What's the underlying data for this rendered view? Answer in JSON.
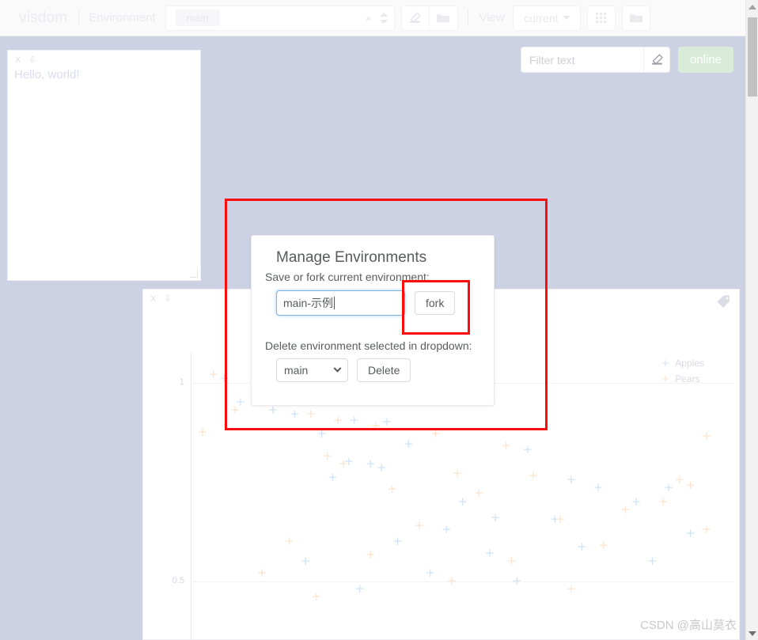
{
  "topbar": {
    "brand": "visdom",
    "env_label": "Environment",
    "env_tag": "main",
    "clear_icon": "×",
    "spinner_up_icon": "caret-up-icon",
    "spinner_down_icon": "caret-down-icon",
    "eraser_icon": "◣",
    "folder_icon": "🗀",
    "view_label": "View",
    "current_dropdown": "current",
    "grid_icon": "grid-icon",
    "folder_icon_2": "🗀"
  },
  "filterbar": {
    "filter_placeholder": "Filter text",
    "filter_value": "",
    "clear_icon": "◣",
    "status_badge": "online",
    "status_color": "#d8ecd9"
  },
  "text_pane": {
    "close_icon": "X",
    "save_icon": "⇩",
    "content": "Hello, world!"
  },
  "plot_pane": {
    "close_icon": "X",
    "save_icon": "⇩",
    "tag_icon": "tag-icon"
  },
  "modal": {
    "title": "Manage Environments",
    "save_label": "Save or fork current environment:",
    "env_name_value": "main-示例",
    "fork_button": "fork",
    "delete_label": "Delete environment selected in dropdown:",
    "env_dropdown_value": "main",
    "delete_button": "Delete"
  },
  "annotations": {
    "outer_rect_color": "#fb0d0d",
    "fork_rect_color": "#fb0d0d"
  },
  "watermark": "CSDN @高山莫衣",
  "scrollbar": {
    "up_arrow": "scroll-up-icon",
    "down_arrow": "scroll-down-icon"
  },
  "chart_data": {
    "type": "scatter",
    "title": "",
    "xlabel": "",
    "ylabel": "",
    "grid": true,
    "legend_position": "top-right",
    "yticks": [
      1,
      0.5
    ],
    "ytick_labels": [
      "1",
      "0.5"
    ],
    "ylim": [
      0.35,
      1.08
    ],
    "xlim": [
      0,
      1
    ],
    "series": [
      {
        "name": "Apples",
        "color": "#cfe3f7",
        "marker": "+",
        "points": [
          [
            0.06,
            1.01
          ],
          [
            0.09,
            0.95
          ],
          [
            0.15,
            0.93
          ],
          [
            0.19,
            0.92
          ],
          [
            0.3,
            0.905
          ],
          [
            0.36,
            0.9
          ],
          [
            0.24,
            0.87
          ],
          [
            0.4,
            0.845
          ],
          [
            0.62,
            0.83
          ],
          [
            0.29,
            0.8
          ],
          [
            0.33,
            0.795
          ],
          [
            0.35,
            0.785
          ],
          [
            0.26,
            0.76
          ],
          [
            0.7,
            0.755
          ],
          [
            0.75,
            0.735
          ],
          [
            0.88,
            0.735
          ],
          [
            0.5,
            0.7
          ],
          [
            0.82,
            0.7
          ],
          [
            0.56,
            0.66
          ],
          [
            0.67,
            0.655
          ],
          [
            0.47,
            0.63
          ],
          [
            0.92,
            0.62
          ],
          [
            0.38,
            0.6
          ],
          [
            0.72,
            0.585
          ],
          [
            0.55,
            0.57
          ],
          [
            0.21,
            0.55
          ],
          [
            0.85,
            0.55
          ],
          [
            0.44,
            0.52
          ],
          [
            0.6,
            0.5
          ],
          [
            0.31,
            0.48
          ]
        ]
      },
      {
        "name": "Pears",
        "color": "#fde4cc",
        "marker": "+",
        "points": [
          [
            0.04,
            1.02
          ],
          [
            0.12,
            0.99
          ],
          [
            0.17,
            0.98
          ],
          [
            0.08,
            0.93
          ],
          [
            0.22,
            0.92
          ],
          [
            0.27,
            0.905
          ],
          [
            0.34,
            0.89
          ],
          [
            0.02,
            0.875
          ],
          [
            0.45,
            0.87
          ],
          [
            0.95,
            0.865
          ],
          [
            0.58,
            0.84
          ],
          [
            0.25,
            0.815
          ],
          [
            0.28,
            0.795
          ],
          [
            0.49,
            0.77
          ],
          [
            0.63,
            0.765
          ],
          [
            0.9,
            0.755
          ],
          [
            0.92,
            0.74
          ],
          [
            0.37,
            0.73
          ],
          [
            0.53,
            0.72
          ],
          [
            0.87,
            0.7
          ],
          [
            0.8,
            0.68
          ],
          [
            0.68,
            0.655
          ],
          [
            0.42,
            0.64
          ],
          [
            0.95,
            0.63
          ],
          [
            0.18,
            0.6
          ],
          [
            0.76,
            0.59
          ],
          [
            0.33,
            0.565
          ],
          [
            0.59,
            0.55
          ],
          [
            0.13,
            0.52
          ],
          [
            0.48,
            0.5
          ],
          [
            0.7,
            0.48
          ],
          [
            0.23,
            0.46
          ]
        ]
      }
    ]
  }
}
